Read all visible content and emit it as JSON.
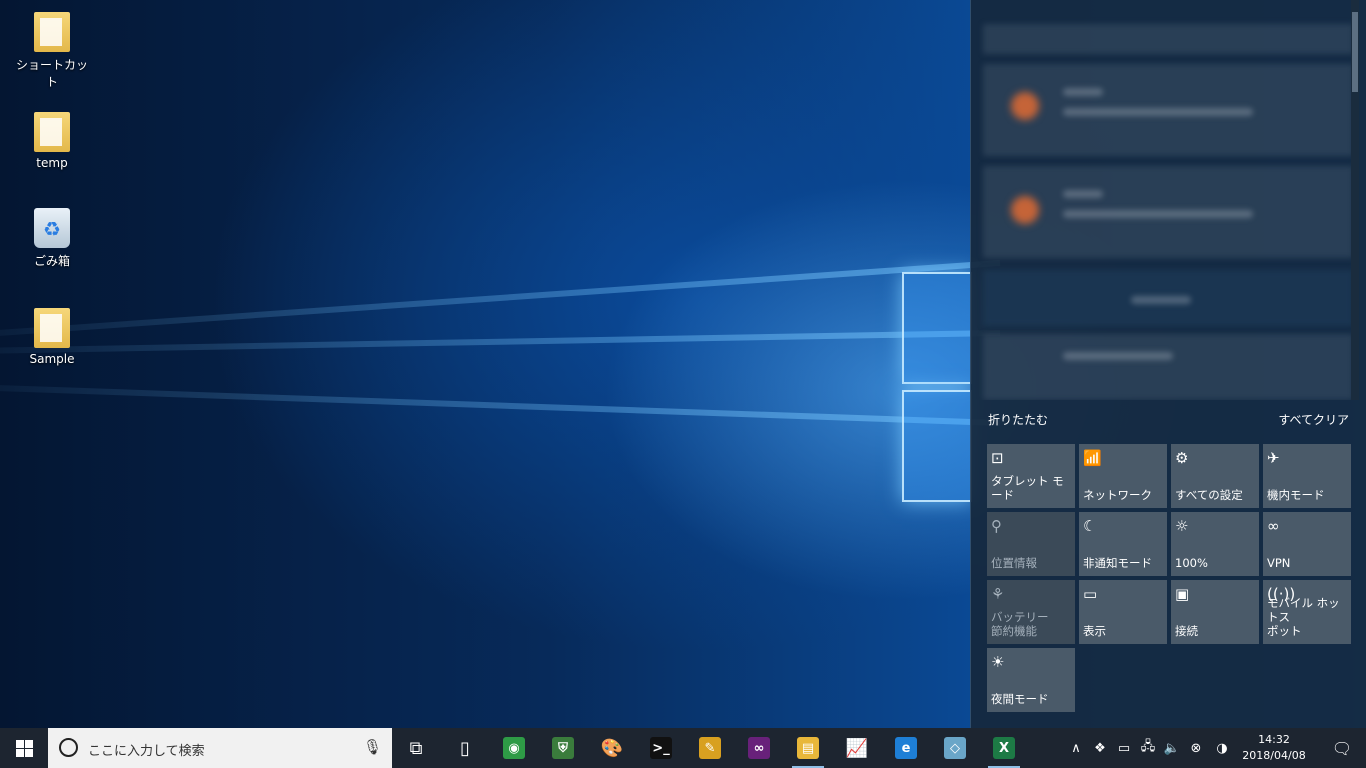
{
  "desktop": {
    "icons": [
      {
        "label": "ショートカット",
        "icon": "folder-icon"
      },
      {
        "label": "temp",
        "icon": "folder-icon"
      },
      {
        "label": "ごみ箱",
        "icon": "recycle-bin-icon"
      },
      {
        "label": "Sample",
        "icon": "folder-icon"
      }
    ]
  },
  "action_center": {
    "collapse_label": "折りたたむ",
    "clear_all_label": "すべてクリア",
    "quick_actions": [
      {
        "label": "タブレット モード",
        "icon": "tablet-mode-icon",
        "glyph": "⊡",
        "enabled": true
      },
      {
        "label": "ネットワーク",
        "icon": "network-icon",
        "glyph": "📶",
        "enabled": true
      },
      {
        "label": "すべての設定",
        "icon": "settings-icon",
        "glyph": "⚙",
        "enabled": true
      },
      {
        "label": "機内モード",
        "icon": "airplane-icon",
        "glyph": "✈",
        "enabled": true
      },
      {
        "label": "位置情報",
        "icon": "location-icon",
        "glyph": "⚲",
        "enabled": false
      },
      {
        "label": "非通知モード",
        "icon": "moon-icon",
        "glyph": "☾",
        "enabled": true
      },
      {
        "label": "100%",
        "icon": "brightness-icon",
        "glyph": "☼",
        "enabled": true
      },
      {
        "label": "VPN",
        "icon": "vpn-icon",
        "glyph": "∞",
        "enabled": true
      },
      {
        "label": "バッテリー\n節約機能",
        "icon": "battery-saver-icon",
        "glyph": "⚘",
        "enabled": false
      },
      {
        "label": "表示",
        "icon": "project-icon",
        "glyph": "▭",
        "enabled": true
      },
      {
        "label": "接続",
        "icon": "connect-icon",
        "glyph": "▣",
        "enabled": true
      },
      {
        "label": "モバイル ホットス\nポット",
        "icon": "hotspot-icon",
        "glyph": "((·))",
        "enabled": true
      },
      {
        "label": "夜間モード",
        "icon": "night-light-icon",
        "glyph": "☀",
        "enabled": true
      }
    ]
  },
  "taskbar": {
    "search_placeholder": "ここに入力して検索",
    "apps": [
      {
        "name": "task-view-icon",
        "glyph": "⧉",
        "bg": "",
        "active": false
      },
      {
        "name": "document-icon",
        "glyph": "▯",
        "bg": "",
        "active": false
      },
      {
        "name": "chrome-icon",
        "glyph": "◉",
        "bg": "#2e9b46",
        "active": false
      },
      {
        "name": "shield-app-icon",
        "glyph": "⛨",
        "bg": "#3a7c3c",
        "active": false
      },
      {
        "name": "paint-icon",
        "glyph": "🎨",
        "bg": "",
        "active": false
      },
      {
        "name": "terminal-icon",
        "glyph": ">_",
        "bg": "#111111",
        "active": false
      },
      {
        "name": "pen-app-icon",
        "glyph": "✎",
        "bg": "#d8a020",
        "active": false
      },
      {
        "name": "visual-studio-icon",
        "glyph": "∞",
        "bg": "#68217a",
        "active": false
      },
      {
        "name": "file-explorer-icon",
        "glyph": "▤",
        "bg": "#e8b73a",
        "active": true
      },
      {
        "name": "chart-app-icon",
        "glyph": "📈",
        "bg": "",
        "active": false
      },
      {
        "name": "internet-explorer-icon",
        "glyph": "e",
        "bg": "#1e7fd6",
        "active": false
      },
      {
        "name": "notes-app-icon",
        "glyph": "◇",
        "bg": "#6aa6c8",
        "active": false
      },
      {
        "name": "excel-icon",
        "glyph": "X",
        "bg": "#1d7a45",
        "active": true
      }
    ],
    "tray": [
      {
        "name": "chevron-up-icon",
        "glyph": "∧"
      },
      {
        "name": "dropbox-icon",
        "glyph": "❖"
      },
      {
        "name": "battery-icon",
        "glyph": "▭"
      },
      {
        "name": "network-tray-icon",
        "glyph": "🖧"
      },
      {
        "name": "volume-icon",
        "glyph": "🔈"
      },
      {
        "name": "error-icon",
        "glyph": "⊗"
      },
      {
        "name": "ime-icon",
        "glyph": "◑"
      }
    ],
    "time": "14:32",
    "date": "2018/04/08"
  }
}
